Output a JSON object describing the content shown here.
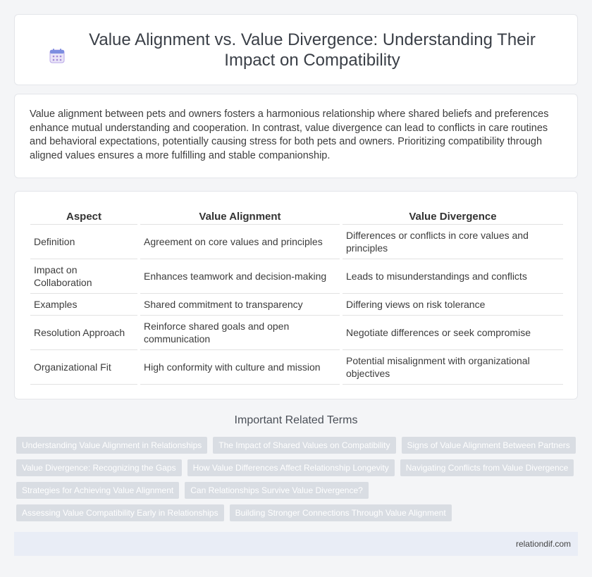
{
  "header": {
    "title": "Value Alignment vs. Value Divergence: Understanding Their Impact on Compatibility",
    "icon": "calendar-icon"
  },
  "intro": {
    "text": "Value alignment between pets and owners fosters a harmonious relationship where shared beliefs and preferences enhance mutual understanding and cooperation. In contrast, value divergence can lead to conflicts in care routines and behavioral expectations, potentially causing stress for both pets and owners. Prioritizing compatibility through aligned values ensures a more fulfilling and stable companionship."
  },
  "table": {
    "headers": [
      "Aspect",
      "Value Alignment",
      "Value Divergence"
    ],
    "rows": [
      [
        "Definition",
        "Agreement on core values and principles",
        "Differences or conflicts in core values and principles"
      ],
      [
        "Impact on Collaboration",
        "Enhances teamwork and decision-making",
        "Leads to misunderstandings and conflicts"
      ],
      [
        "Examples",
        "Shared commitment to transparency",
        "Differing views on risk tolerance"
      ],
      [
        "Resolution Approach",
        "Reinforce shared goals and open communication",
        "Negotiate differences or seek compromise"
      ],
      [
        "Organizational Fit",
        "High conformity with culture and mission",
        "Potential misalignment with organizational objectives"
      ]
    ]
  },
  "related": {
    "title": "Important Related Terms",
    "tags": [
      "Understanding Value Alignment in Relationships",
      "The Impact of Shared Values on Compatibility",
      "Signs of Value Alignment Between Partners",
      "Value Divergence: Recognizing the Gaps",
      "How Value Differences Affect Relationship Longevity",
      "Navigating Conflicts from Value Divergence",
      "Strategies for Achieving Value Alignment",
      "Can Relationships Survive Value Divergence?",
      "Assessing Value Compatibility Early in Relationships",
      "Building Stronger Connections Through Value Alignment"
    ]
  },
  "footer": {
    "site": "relationdif.com"
  }
}
